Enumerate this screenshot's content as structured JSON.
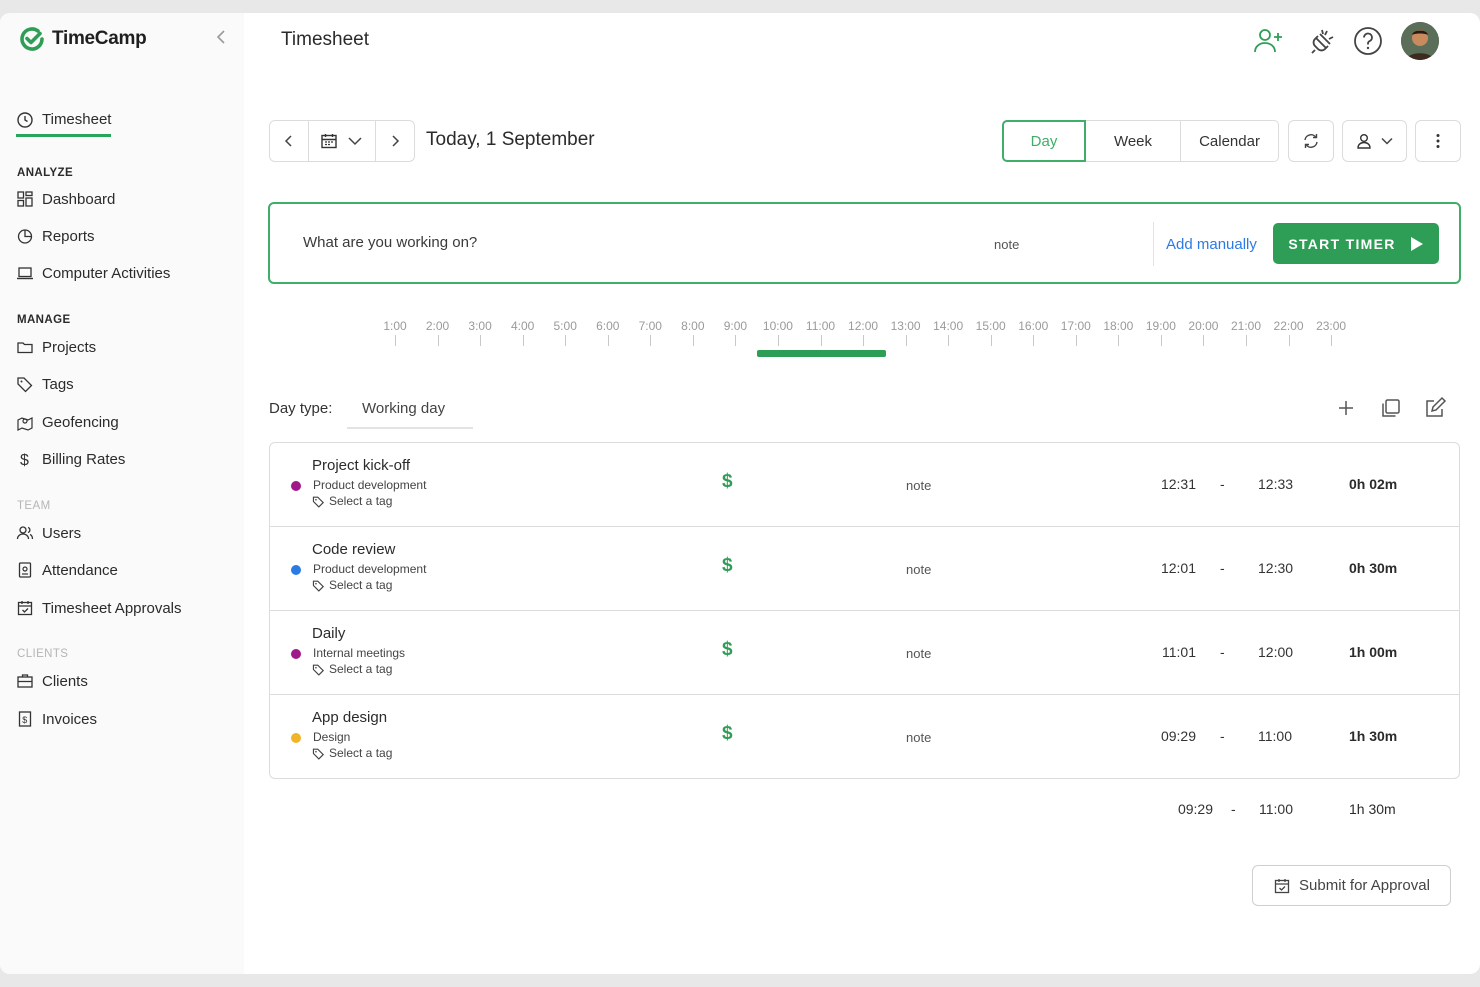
{
  "app": {
    "name": "TimeCamp",
    "page_title": "Timesheet"
  },
  "sidebar": {
    "active": {
      "label": "Timesheet"
    },
    "sections": [
      {
        "label": "ANALYZE",
        "items": [
          "Dashboard",
          "Reports",
          "Computer Activities"
        ]
      },
      {
        "label": "MANAGE",
        "items": [
          "Projects",
          "Tags",
          "Geofencing",
          "Billing Rates"
        ]
      },
      {
        "label": "TEAM",
        "items": [
          "Users",
          "Attendance",
          "Timesheet Approvals"
        ]
      },
      {
        "label": "CLIENTS",
        "items": [
          "Clients",
          "Invoices"
        ]
      }
    ]
  },
  "header_icons": [
    "add-user-icon",
    "plugin-icon",
    "help-icon",
    "avatar"
  ],
  "date_nav": {
    "label": "Today, 1 September"
  },
  "view_tabs": [
    "Day",
    "Week",
    "Calendar"
  ],
  "active_view": "Day",
  "timer": {
    "placeholder": "What are you working on?",
    "note": "note",
    "add_manually": "Add manually",
    "start": "START TIMER"
  },
  "timeline": {
    "hours": [
      "1:00",
      "2:00",
      "3:00",
      "4:00",
      "5:00",
      "6:00",
      "7:00",
      "8:00",
      "9:00",
      "10:00",
      "11:00",
      "12:00",
      "13:00",
      "14:00",
      "15:00",
      "16:00",
      "17:00",
      "18:00",
      "19:00",
      "20:00",
      "21:00",
      "22:00",
      "23:00"
    ],
    "tracked_from": 9.5,
    "tracked_to": 12.55
  },
  "day_type": {
    "label": "Day type:",
    "value": "Working day"
  },
  "entries": [
    {
      "name": "Project kick-off",
      "project": "Product development",
      "tag": "Select a tag",
      "note": "note",
      "start": "12:31",
      "end": "12:33",
      "duration": "0h 02m",
      "color": "#a0198a"
    },
    {
      "name": "Code review",
      "project": "Product development",
      "tag": "Select a tag",
      "note": "note",
      "start": "12:01",
      "end": "12:30",
      "duration": "0h 30m",
      "color": "#2c7be5"
    },
    {
      "name": "Daily",
      "project": "Internal meetings",
      "tag": "Select a tag",
      "note": "note",
      "start": "11:01",
      "end": "12:00",
      "duration": "1h 00m",
      "color": "#a0198a"
    },
    {
      "name": "App design",
      "project": "Design",
      "tag": "Select a tag",
      "note": "note",
      "start": "09:29",
      "end": "11:00",
      "duration": "1h 30m",
      "color": "#f0b429"
    }
  ],
  "summary": {
    "start": "09:29",
    "dash": "-",
    "end": "11:00",
    "duration": "1h 30m"
  },
  "submit_label": "Submit for Approval",
  "colors": {
    "accent": "#2e9e57",
    "link": "#2c7be5"
  }
}
